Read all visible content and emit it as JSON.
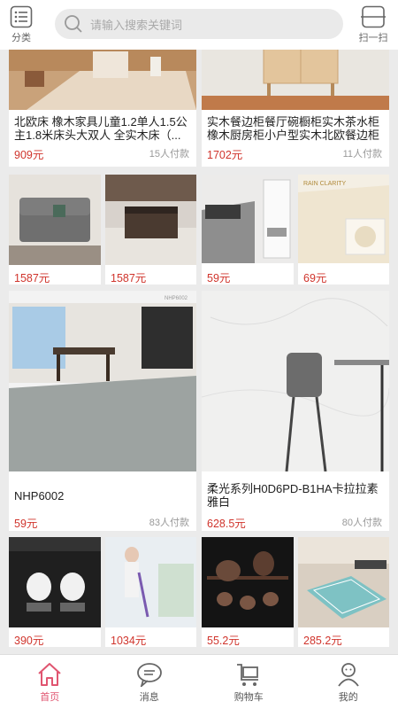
{
  "header": {
    "category_label": "分类",
    "search_placeholder": "请输入搜索关键词",
    "scan_label": "扫一扫"
  },
  "row1": [
    {
      "title": "北欧床 橡木家具儿童1.2单人1.5公主1.8米床头大双人 全实木床（...",
      "price": "909元",
      "sold": "15人付款"
    },
    {
      "title": "实木餐边柜餐厅碗橱柜实木茶水柜橡木厨房柜小户型实木北欧餐边柜",
      "price": "1702元",
      "sold": "11人付款"
    }
  ],
  "row2": [
    {
      "price": "1587元"
    },
    {
      "price": "1587元"
    },
    {
      "price": "59元",
      "image_text": "RAIN CLARITY"
    },
    {
      "price": "69元",
      "image_text": "RAIN CLARITY"
    }
  ],
  "row3": [
    {
      "title": "NHP6002",
      "price": "59元",
      "sold": "83人付款",
      "image_text": "NHP6002"
    },
    {
      "title": "柔光系列H0D6PD-B1HA卡拉拉素雅白",
      "price": "628.5元",
      "sold": "80人付款"
    }
  ],
  "row4": [
    {
      "price": "390元"
    },
    {
      "price": "1034元"
    },
    {
      "price": "55.2元"
    },
    {
      "price": "285.2元"
    }
  ],
  "tabs": [
    {
      "label": "首页",
      "icon": "home-icon"
    },
    {
      "label": "消息",
      "icon": "message-icon"
    },
    {
      "label": "购物车",
      "icon": "cart-icon"
    },
    {
      "label": "我的",
      "icon": "user-icon"
    }
  ],
  "colors": {
    "price": "#d0342c",
    "active_tab": "#e05570"
  }
}
